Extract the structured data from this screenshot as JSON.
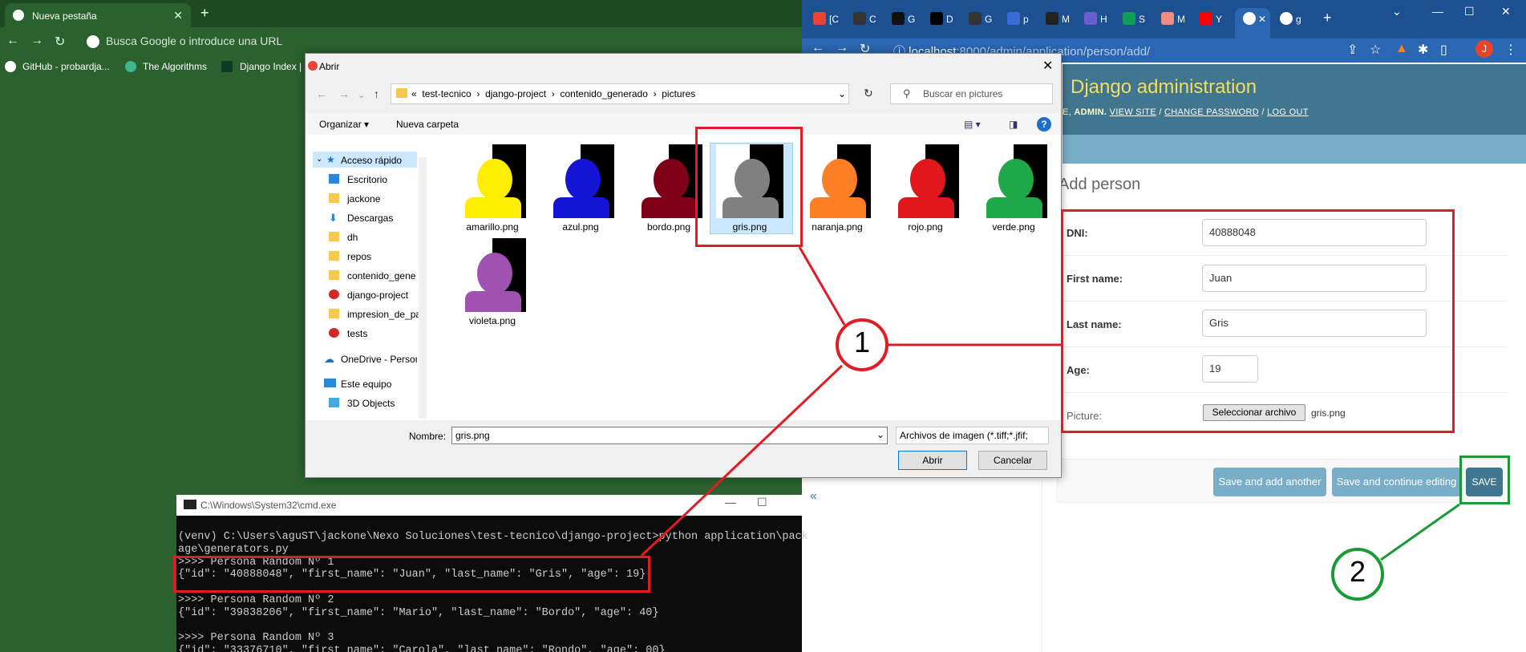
{
  "left_window": {
    "tab_title": "Nueva pestaña",
    "omnibox_placeholder": "Busca Google o introduce una URL",
    "bookmarks": [
      "GitHub - probardja...",
      "The Algorithms",
      "Django Index |"
    ]
  },
  "right_window": {
    "url_host": "localhost",
    "url_path": ":8000/admin/application/person/add/",
    "avatar_letter": "J",
    "tab_labels": [
      "[C",
      "C",
      "G",
      "D",
      "G",
      "p",
      "M",
      "H",
      "S",
      "M",
      "Y",
      "g"
    ]
  },
  "django": {
    "site_title": "Django administration",
    "user_prefix": "E,",
    "user_name": "ADMIN.",
    "links": [
      "VIEW SITE",
      "CHANGE PASSWORD",
      "LOG OUT"
    ],
    "page_title": "Add person",
    "fields": [
      {
        "label": "DNI:",
        "value": "40888048"
      },
      {
        "label": "First name:",
        "value": "Juan"
      },
      {
        "label": "Last name:",
        "value": "Gris"
      },
      {
        "label": "Age:",
        "value": "19"
      }
    ],
    "picture_label": "Picture:",
    "file_button": "Seleccionar archivo",
    "file_name": "gris.png",
    "buttons": {
      "save_add": "Save and add another",
      "save_continue": "Save and continue editing",
      "save": "SAVE"
    },
    "collapse": "«"
  },
  "dialog": {
    "title": "Abrir",
    "path": [
      "«",
      "test-tecnico",
      "django-project",
      "contenido_generado",
      "pictures"
    ],
    "search_placeholder": "Buscar en pictures",
    "organize": "Organizar ▾",
    "new_folder": "Nueva carpeta",
    "sidebar": [
      "Acceso rápido",
      "Escritorio",
      "jackone",
      "Descargas",
      "dh",
      "repos",
      "contenido_gene",
      "django-project",
      "impresion_de_pa",
      "tests",
      "OneDrive - Person",
      "Este equipo",
      "3D Objects"
    ],
    "files": [
      {
        "name": "amarillo.png",
        "color": "#ffee00"
      },
      {
        "name": "azul.png",
        "color": "#1414d4"
      },
      {
        "name": "bordo.png",
        "color": "#800018"
      },
      {
        "name": "gris.png",
        "color": "#808080"
      },
      {
        "name": "naranja.png",
        "color": "#ff7f27"
      },
      {
        "name": "rojo.png",
        "color": "#e0181e"
      },
      {
        "name": "verde.png",
        "color": "#1fa848"
      },
      {
        "name": "violeta.png",
        "color": "#a052b0"
      }
    ],
    "name_label": "Nombre:",
    "name_value": "gris.png",
    "type_value": "Archivos de imagen (*.tiff;*.jfif;",
    "open": "Abrir",
    "cancel": "Cancelar"
  },
  "cmd": {
    "title": "C:\\Windows\\System32\\cmd.exe",
    "lines": [
      "(venv) C:\\Users\\aguST\\jackone\\Nexo Soluciones\\test-tecnico\\django-project>python application\\pack",
      "age\\generators.py",
      ">>>> Persona Random Nº 1",
      "{\"id\": \"40888048\", \"first_name\": \"Juan\", \"last_name\": \"Gris\", \"age\": 19}",
      "",
      ">>>> Persona Random Nº 2",
      "{\"id\": \"39838206\", \"first_name\": \"Mario\", \"last_name\": \"Bordo\", \"age\": 40}",
      "",
      ">>>> Persona Random Nº 3",
      "{\"id\": \"33376710\", \"first_name\": \"Carola\", \"last_name\": \"Rondo\", \"age\": 00}"
    ]
  },
  "annotations": {
    "one": "1",
    "two": "2"
  },
  "colors": {
    "red": "#e01c24",
    "green": "#1a9a35",
    "django_header": "#417690",
    "django_title": "#f5dd5d"
  }
}
